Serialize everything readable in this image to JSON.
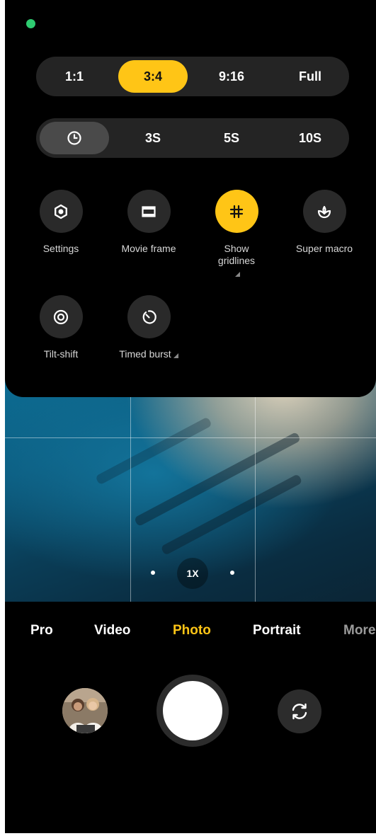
{
  "aspect_ratio": {
    "options": [
      "1:1",
      "3:4",
      "9:16",
      "Full"
    ],
    "selected": "3:4"
  },
  "timer": {
    "off_icon": "clock-icon",
    "options": [
      "3S",
      "5S",
      "10S"
    ]
  },
  "tools": [
    {
      "label": "Settings",
      "icon": "gear-icon",
      "active": false
    },
    {
      "label": "Movie frame",
      "icon": "movie-frame-icon",
      "active": false
    },
    {
      "label": "Show gridlines",
      "icon": "grid-icon",
      "active": true
    },
    {
      "label": "Super macro",
      "icon": "macro-flower-icon",
      "active": false
    },
    {
      "label": "Tilt-shift",
      "icon": "tilt-shift-icon",
      "active": false
    },
    {
      "label": "Timed burst",
      "icon": "timed-burst-icon",
      "active": false
    }
  ],
  "zoom": {
    "label": "1X"
  },
  "modes": [
    "Pro",
    "Video",
    "Photo",
    "Portrait",
    "More"
  ],
  "active_mode": "Photo",
  "colors": {
    "accent": "#ffc516",
    "status_dot": "#2ecc71"
  }
}
